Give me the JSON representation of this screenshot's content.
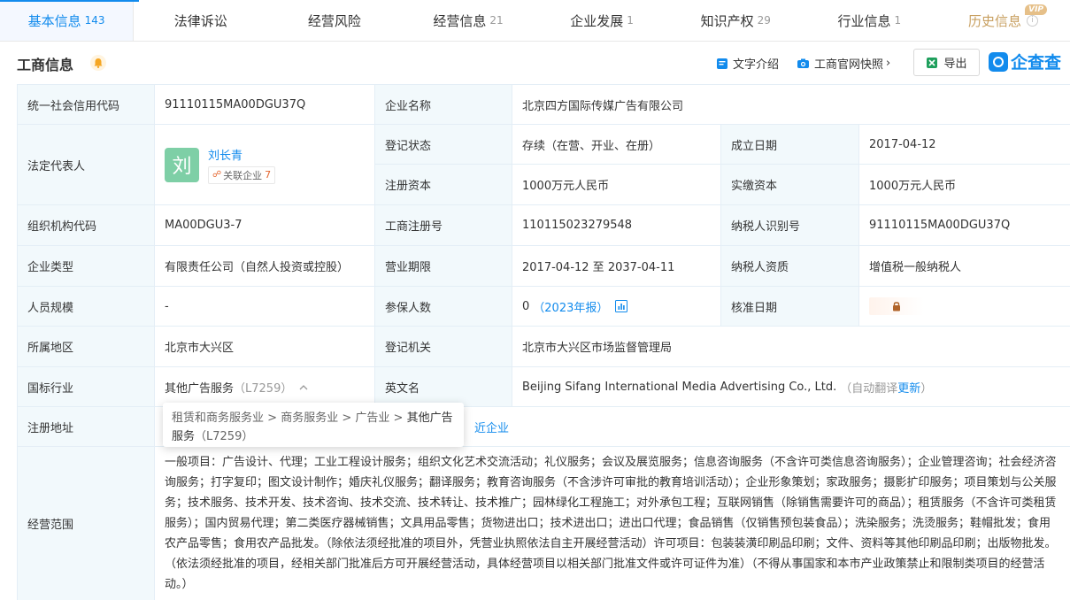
{
  "tabs": [
    {
      "label": "基本信息",
      "count": "143"
    },
    {
      "label": "法律诉讼",
      "count": ""
    },
    {
      "label": "经营风险",
      "count": ""
    },
    {
      "label": "经营信息",
      "count": "21"
    },
    {
      "label": "企业发展",
      "count": "1"
    },
    {
      "label": "知识产权",
      "count": "29"
    },
    {
      "label": "行业信息",
      "count": "1"
    },
    {
      "label": "历史信息",
      "count": "",
      "badge": "VIP"
    }
  ],
  "section": {
    "title": "工商信息",
    "text_intro": "文字介绍",
    "snapshot": "工商官网快照",
    "export": "导出",
    "brand": "企查查"
  },
  "colors": {
    "accent": "#128bed",
    "label_bg": "#f2f9fc",
    "border": "#e4eef6",
    "avatar": "#7ecfa6",
    "vip": "#e6c089"
  },
  "fields": {
    "credit_code_label": "统一社会信用代码",
    "credit_code": "91110115MA00DGU37Q",
    "company_name_label": "企业名称",
    "company_name": "北京四方国际传媒广告有限公司",
    "legal_rep_label": "法定代表人",
    "legal_rep_avatar": "刘",
    "legal_rep_name": "刘长青",
    "related_label": "关联企业",
    "related_count": "7",
    "reg_status_label": "登记状态",
    "reg_status": "存续（在营、开业、在册）",
    "found_date_label": "成立日期",
    "found_date": "2017-04-12",
    "reg_capital_label": "注册资本",
    "reg_capital": "1000万元人民币",
    "paid_capital_label": "实缴资本",
    "paid_capital": "1000万元人民币",
    "org_code_label": "组织机构代码",
    "org_code": "MA00DGU3-7",
    "biz_reg_no_label": "工商注册号",
    "biz_reg_no": "110115023279548",
    "taxpayer_id_label": "纳税人识别号",
    "taxpayer_id": "91110115MA00DGU37Q",
    "company_type_label": "企业类型",
    "company_type": "有限责任公司（自然人投资或控股）",
    "term_label": "营业期限",
    "term": "2017-04-12 至 2037-04-11",
    "taxpayer_qual_label": "纳税人资质",
    "taxpayer_qual": "增值税一般纳税人",
    "staff_size_label": "人员规模",
    "staff_size": "-",
    "insured_label": "参保人数",
    "insured": "0",
    "insured_report": "（2023年报）",
    "approve_date_label": "核准日期",
    "region_label": "所属地区",
    "region": "北京市大兴区",
    "reg_authority_label": "登记机关",
    "reg_authority": "北京市大兴区市场监督管理局",
    "industry_label": "国标行业",
    "industry": "其他广告服务",
    "industry_code": "（L7259）",
    "english_name_label": "英文名",
    "english_name": "Beijing Sifang International Media Advertising Co., Ltd.",
    "auto_translate": "（自动翻译",
    "update": "更新",
    "auto_translate_end": "）",
    "address_label": "注册地址",
    "nearby": "近企业",
    "scope_label": "经营范围",
    "scope": "一般项目：广告设计、代理；工业工程设计服务；组织文化艺术交流活动；礼仪服务；会议及展览服务；信息咨询服务（不含许可类信息咨询服务）；企业管理咨询；社会经济咨询服务；打字复印；图文设计制作；婚庆礼仪服务；翻译服务；教育咨询服务（不含涉许可审批的教育培训活动）；企业形象策划；家政服务；摄影扩印服务；项目策划与公关服务；技术服务、技术开发、技术咨询、技术交流、技术转让、技术推广；园林绿化工程施工；对外承包工程；互联网销售（除销售需要许可的商品）；租赁服务（不含许可类租赁服务）；国内贸易代理；第二类医疗器械销售；文具用品零售；货物进出口；技术进出口；进出口代理；食品销售（仅销售预包装食品）；洗染服务；洗烫服务；鞋帽批发；食用农产品零售；食用农产品批发。（除依法须经批准的项目外，凭营业执照依法自主开展经营活动）许可项目：包装装潢印刷品印刷；文件、资料等其他印刷品印刷；出版物批发。（依法须经批准的项目，经相关部门批准后方可开展经营活动，具体经营项目以相关部门批准文件或许可证件为准）（不得从事国家和本市产业政策禁止和限制类项目的经营活动。）"
  },
  "tooltip": {
    "path1": "租赁和商务服务业",
    "sep": " > ",
    "path2": "商务服务业",
    "path3": "广告业",
    "path4": "其他广告服务",
    "code": "（L7259）"
  }
}
